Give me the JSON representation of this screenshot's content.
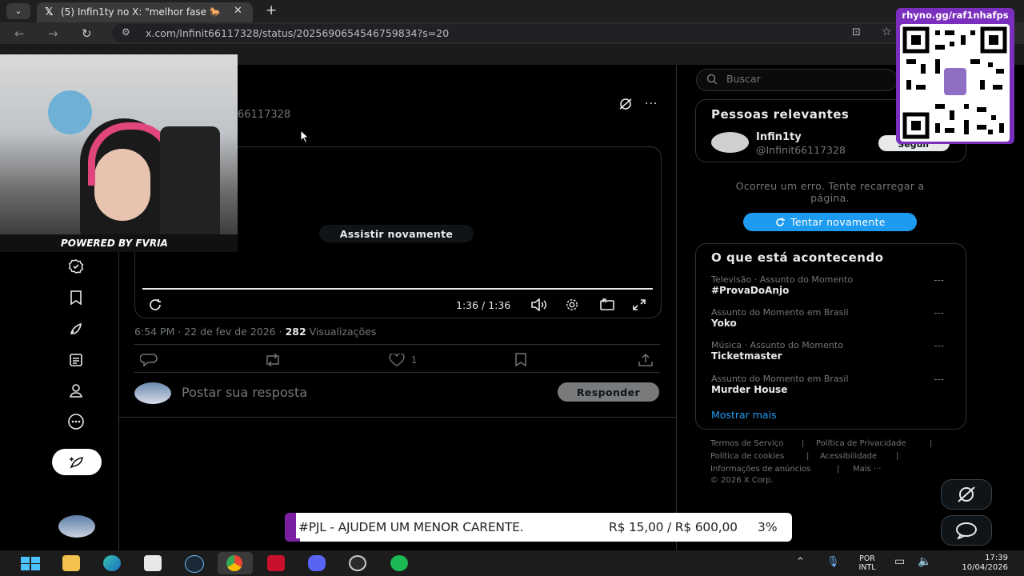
{
  "browser": {
    "tab_title": "(5) Infin1ty no X: \"melhor fase 🐎",
    "url": "x.com/Infinit66117328/status/2025690654546759834?s=20"
  },
  "tweet": {
    "handle_partial": "66117328",
    "replay_label": "Assistir novamente",
    "video_time": "1:36 / 1:36",
    "meta_time": "6:54 PM · 22 de fev de 2026 ·",
    "views_count": "282",
    "views_label": "Visualizações",
    "likes_count": "1",
    "reply_placeholder": "Postar sua resposta",
    "reply_button": "Responder"
  },
  "sidebar_right": {
    "search_placeholder": "Buscar",
    "relevant_title": "Pessoas relevantes",
    "person_name": "Infin1ty",
    "person_handle": "@Infinit66117328",
    "follow_label": "Seguir",
    "error_text": "Ocorreu um erro. Tente recarregar a página.",
    "retry_label": "Tentar novamente",
    "trends_title": "O que está acontecendo",
    "trends": [
      {
        "category": "Televisão · Assunto do Momento",
        "name": "#ProvaDoAnjo"
      },
      {
        "category": "Assunto do Momento em Brasil",
        "name": "Yoko"
      },
      {
        "category": "Música · Assunto do Momento",
        "name": "Ticketmaster"
      },
      {
        "category": "Assunto do Momento em Brasil",
        "name": "Murder House"
      }
    ],
    "trend_more": "---",
    "show_more": "Mostrar mais",
    "footer": {
      "terms": "Termos de Serviço",
      "privacy": "Política de Privacidade",
      "cookies": "Política de cookies",
      "accessibility": "Acessibilidade",
      "ads": "Informações de anúncios",
      "more": "Mais ···",
      "copyright": "© 2026 X Corp."
    }
  },
  "overlay": {
    "webcam_brand": "POWERED BY FVRIA",
    "qr_url": "rhyno.gg/raf1nhafps",
    "donation_text": "#PJL - AJUDEM UM MENOR CARENTE.",
    "donation_amount": "R$ 15,00 / R$ 600,00",
    "donation_percent": "3%",
    "donation_progress": 0.03
  },
  "taskbar": {
    "lang_line1": "POR",
    "lang_line2": "INTL",
    "time": "17:39",
    "date": "10/04/2026"
  },
  "colors": {
    "accent": "#1d9bf0",
    "donation_purple": "#7b1fa2",
    "qr_border": "#7b2fbe"
  }
}
